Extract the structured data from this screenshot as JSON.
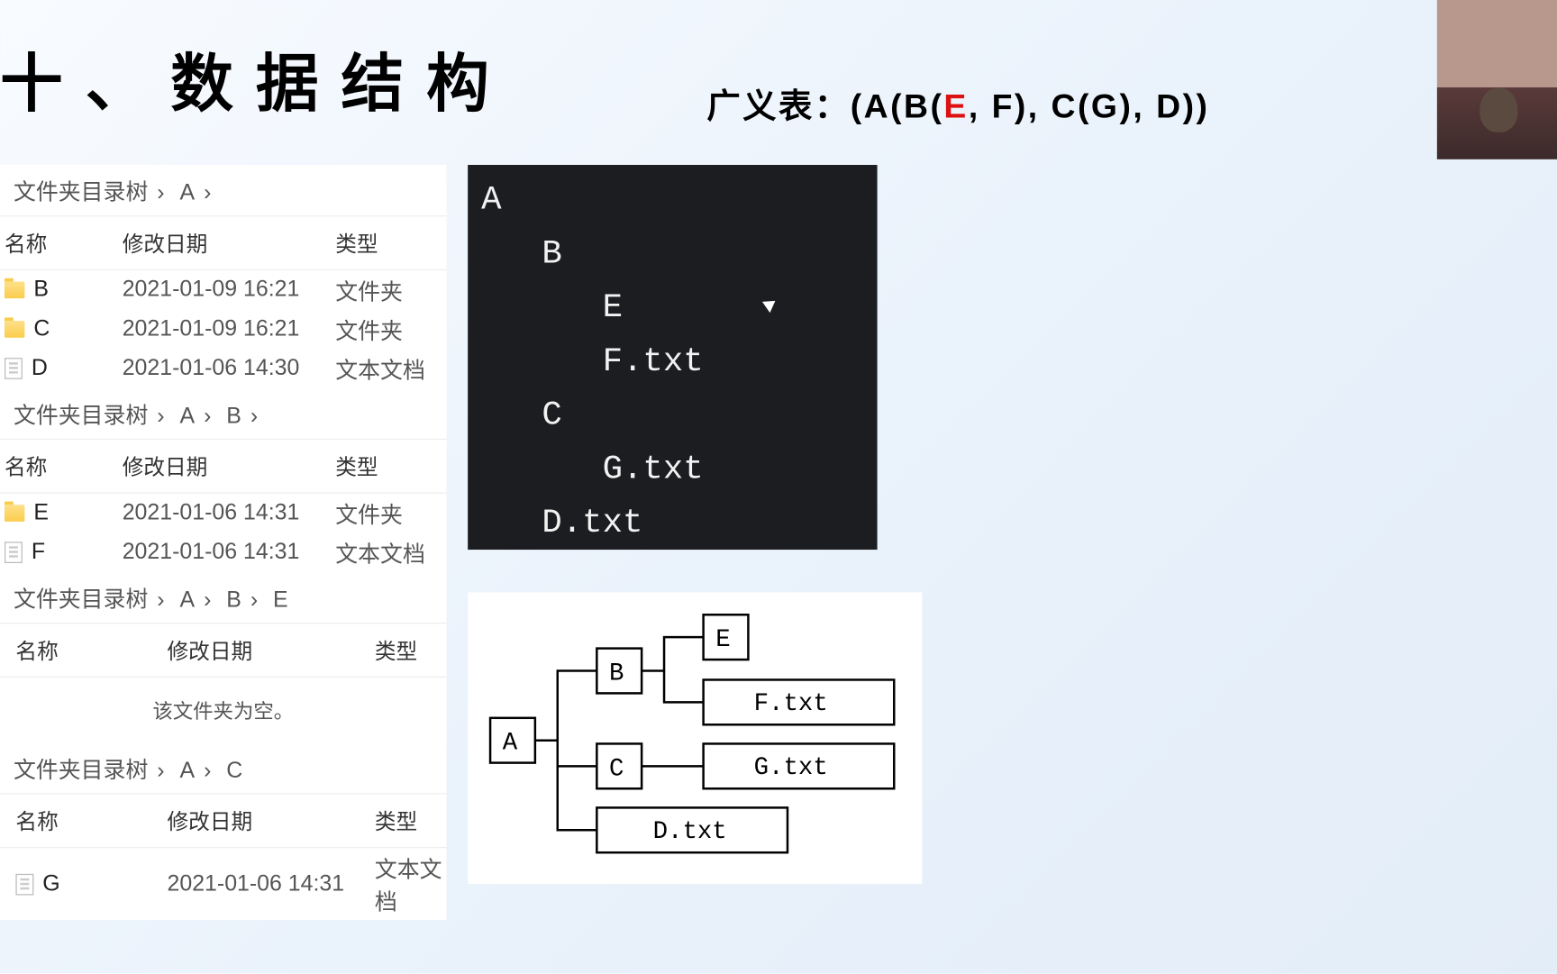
{
  "title": "十、数据结构",
  "gentable": {
    "label": "广义表：",
    "expr_pre": "(A(B(",
    "expr_red": "E",
    "expr_post": ", F), C(G), D))"
  },
  "headers": {
    "name": "名称",
    "mtime": "修改日期",
    "type": "类型"
  },
  "types": {
    "folder": "文件夹",
    "text": "文本文档"
  },
  "crumb_root": "文件夹目录树",
  "empty_text": "该文件夹为空。",
  "panelA": {
    "path": [
      "A"
    ],
    "rows": [
      {
        "icon": "folder",
        "name": "B",
        "mtime": "2021-01-09 16:21",
        "type": "文件夹"
      },
      {
        "icon": "folder",
        "name": "C",
        "mtime": "2021-01-09 16:21",
        "type": "文件夹"
      },
      {
        "icon": "file",
        "name": "D",
        "mtime": "2021-01-06 14:30",
        "type": "文本文档"
      }
    ]
  },
  "panelB": {
    "path": [
      "A",
      "B"
    ],
    "rows": [
      {
        "icon": "folder",
        "name": "E",
        "mtime": "2021-01-06 14:31",
        "type": "文件夹"
      },
      {
        "icon": "file",
        "name": "F",
        "mtime": "2021-01-06 14:31",
        "type": "文本文档"
      }
    ]
  },
  "panelE": {
    "path": [
      "A",
      "B",
      "E"
    ],
    "rows": []
  },
  "panelC": {
    "path": [
      "A",
      "C"
    ],
    "rows": [
      {
        "icon": "file",
        "name": "G",
        "mtime": "2021-01-06 14:31",
        "type": "文本文档"
      }
    ]
  },
  "terminal": "A\n   B\n      E\n      F.txt\n   C\n      G.txt\n   D.txt",
  "tree": {
    "A": "A",
    "B": "B",
    "C": "C",
    "E": "E",
    "F": "F.txt",
    "G": "G.txt",
    "D": "D.txt"
  }
}
